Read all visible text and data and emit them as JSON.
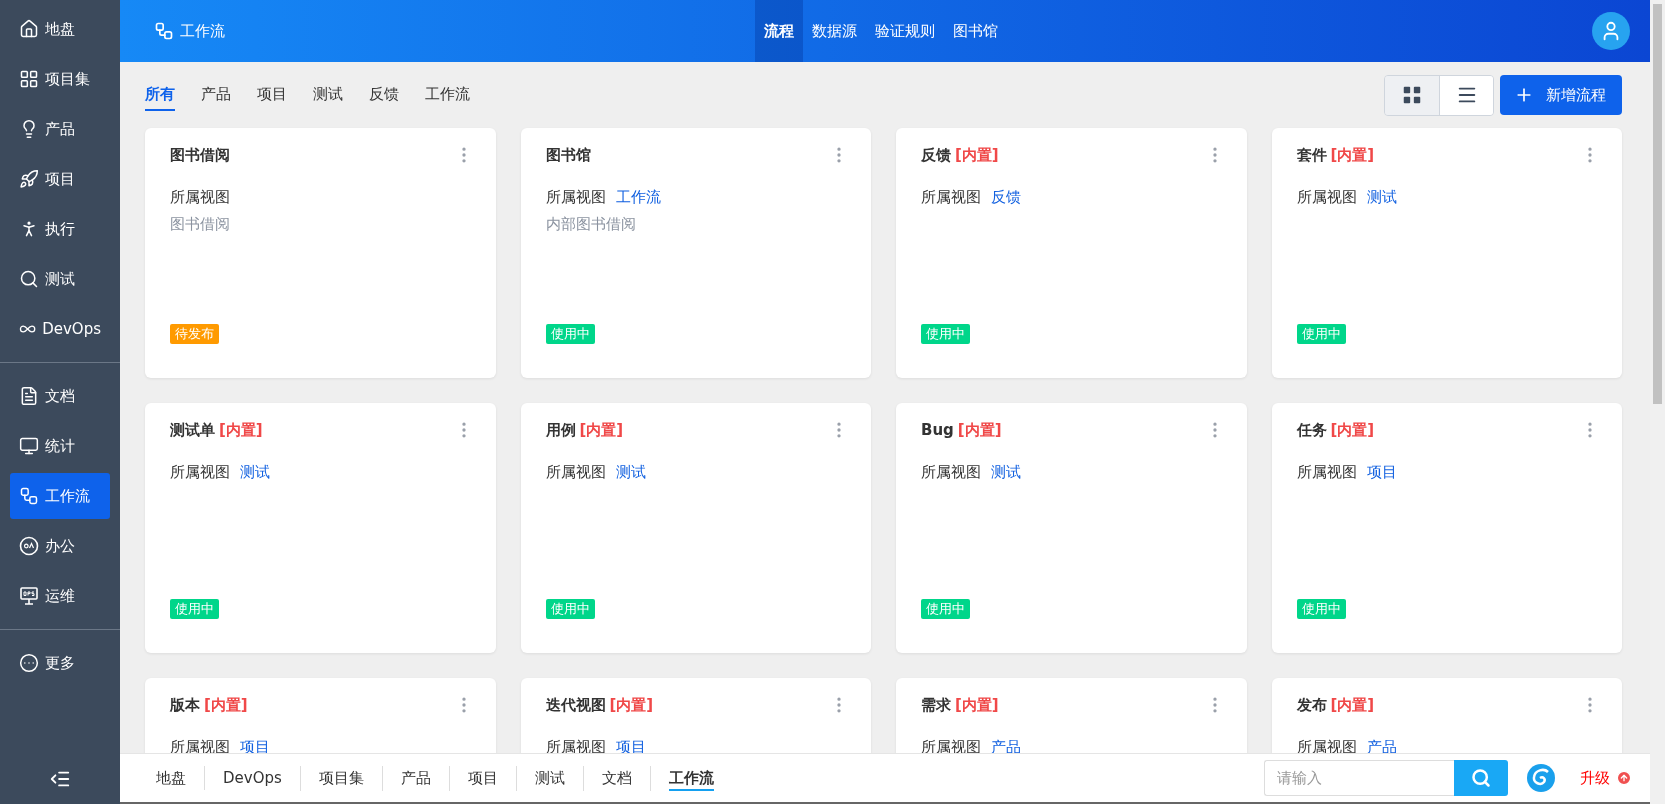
{
  "sidebar": {
    "groups": [
      {
        "items": [
          {
            "label": "地盘",
            "selected": false
          },
          {
            "label": "项目集",
            "selected": false
          },
          {
            "label": "产品",
            "selected": false
          },
          {
            "label": "项目",
            "selected": false
          },
          {
            "label": "执行",
            "selected": false
          },
          {
            "label": "测试",
            "selected": false
          },
          {
            "label": "DevOps",
            "selected": false
          }
        ]
      },
      {
        "items": [
          {
            "label": "文档",
            "selected": false
          },
          {
            "label": "统计",
            "selected": false
          },
          {
            "label": "工作流",
            "selected": true
          },
          {
            "label": "办公",
            "selected": false
          },
          {
            "label": "运维",
            "selected": false
          }
        ]
      },
      {
        "items": [
          {
            "label": "更多",
            "selected": false
          }
        ]
      }
    ]
  },
  "header": {
    "title": "工作流",
    "nav": [
      {
        "label": "流程",
        "selected": true
      },
      {
        "label": "数据源",
        "selected": false
      },
      {
        "label": "验证规则",
        "selected": false
      },
      {
        "label": "图书馆",
        "selected": false
      }
    ]
  },
  "filter_tabs": [
    {
      "label": "所有",
      "selected": true
    },
    {
      "label": "产品",
      "selected": false
    },
    {
      "label": "项目",
      "selected": false
    },
    {
      "label": "测试",
      "selected": false
    },
    {
      "label": "反馈",
      "selected": false
    },
    {
      "label": "工作流",
      "selected": false
    }
  ],
  "view_toggle": [
    {
      "kind": "grid",
      "selected": true
    },
    {
      "kind": "list",
      "selected": false
    }
  ],
  "add_button": "新增流程",
  "cards": [
    {
      "title": "图书借阅",
      "view_label": "所属视图",
      "description": "图书借阅",
      "status": {
        "kind": "pending",
        "label": "待发布"
      }
    },
    {
      "title": "图书馆",
      "view_label": "所属视图",
      "view": "工作流",
      "description": "内部图书借阅",
      "status": {
        "kind": "active",
        "label": "使用中"
      }
    },
    {
      "title": "反馈",
      "tag": "[内置]",
      "view_label": "所属视图",
      "view": "反馈",
      "status": {
        "kind": "active",
        "label": "使用中"
      }
    },
    {
      "title": "套件",
      "tag": "[内置]",
      "view_label": "所属视图",
      "view": "测试",
      "status": {
        "kind": "active",
        "label": "使用中"
      }
    },
    {
      "title": "测试单",
      "tag": "[内置]",
      "view_label": "所属视图",
      "view": "测试",
      "status": {
        "kind": "active",
        "label": "使用中"
      }
    },
    {
      "title": "用例",
      "tag": "[内置]",
      "view_label": "所属视图",
      "view": "测试",
      "status": {
        "kind": "active",
        "label": "使用中"
      }
    },
    {
      "title": "Bug",
      "tag": "[内置]",
      "view_label": "所属视图",
      "view": "测试",
      "status": {
        "kind": "active",
        "label": "使用中"
      }
    },
    {
      "title": "任务",
      "tag": "[内置]",
      "view_label": "所属视图",
      "view": "项目",
      "status": {
        "kind": "active",
        "label": "使用中"
      }
    },
    {
      "title": "版本",
      "tag": "[内置]",
      "view_label": "所属视图",
      "view": "项目"
    },
    {
      "title": "迭代视图",
      "tag": "[内置]",
      "view_label": "所属视图",
      "view": "项目"
    },
    {
      "title": "需求",
      "tag": "[内置]",
      "view_label": "所属视图",
      "view": "产品"
    },
    {
      "title": "发布",
      "tag": "[内置]",
      "view_label": "所属视图",
      "view": "产品"
    }
  ],
  "bottom_bar": {
    "tabs": [
      {
        "label": "地盘",
        "selected": false
      },
      {
        "label": "DevOps",
        "selected": false
      },
      {
        "label": "项目集",
        "selected": false
      },
      {
        "label": "产品",
        "selected": false
      },
      {
        "label": "项目",
        "selected": false
      },
      {
        "label": "测试",
        "selected": false
      },
      {
        "label": "文档",
        "selected": false
      },
      {
        "label": "工作流",
        "selected": true
      }
    ],
    "search": {
      "placeholder": "请输入"
    },
    "upgrade": "升级"
  }
}
